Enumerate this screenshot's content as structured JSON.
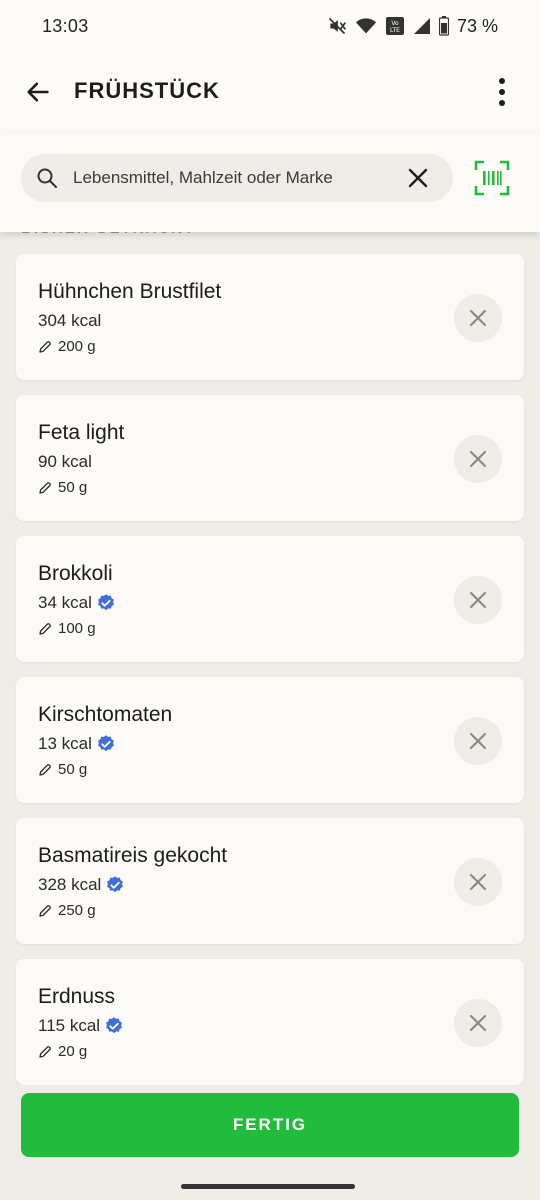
{
  "status_bar": {
    "time": "13:03",
    "battery_percent": "73 %",
    "volte": "Vo LTE"
  },
  "header": {
    "title": "FRÜHSTÜCK",
    "back_icon": "arrow-left-icon",
    "more_icon": "more-vert-icon"
  },
  "search": {
    "placeholder": "Lebensmittel, Mahlzeit oder Marke",
    "value": ""
  },
  "section": {
    "label": "BISHER GETRACKT"
  },
  "colors": {
    "accent_green": "#21bc3c",
    "verified_blue": "#3f6fd6",
    "background": "#efebe6",
    "card": "#fbfaf7"
  },
  "foods": [
    {
      "name": "Hühnchen Brustfilet",
      "kcal": "304 kcal",
      "amount": "200 g",
      "verified": false
    },
    {
      "name": "Feta light",
      "kcal": "90 kcal",
      "amount": "50 g",
      "verified": false
    },
    {
      "name": "Brokkoli",
      "kcal": "34 kcal",
      "amount": "100 g",
      "verified": true
    },
    {
      "name": "Kirschtomaten",
      "kcal": "13 kcal",
      "amount": "50 g",
      "verified": true
    },
    {
      "name": "Basmatireis gekocht",
      "kcal": "328 kcal",
      "amount": "250 g",
      "verified": true
    },
    {
      "name": "Erdnuss",
      "kcal": "115 kcal",
      "amount": "20 g",
      "verified": true
    }
  ],
  "footer": {
    "done_label": "FERTIG"
  }
}
